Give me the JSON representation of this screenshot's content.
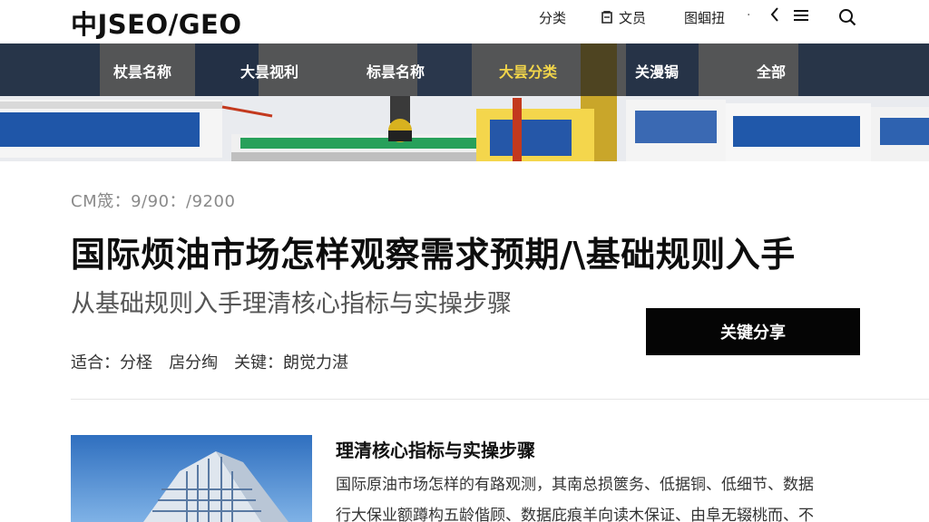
{
  "header": {
    "logo": "中JSEO/GEO",
    "nav": {
      "category": "分类",
      "doc": "文员",
      "images": "图蝈扭",
      "dot": "·"
    },
    "icons": [
      "doc-icon",
      "back-chevron-icon",
      "menu-icon",
      "search-icon"
    ]
  },
  "banner": {
    "categories": [
      {
        "label": "杖昙名称",
        "active": false
      },
      {
        "label": "大昙视利",
        "active": false
      },
      {
        "label": "标昙名称",
        "active": false
      },
      {
        "label": "大昙分类",
        "active": true
      },
      {
        "label": "关漫锔",
        "active": false
      },
      {
        "label": "全部",
        "active": false
      }
    ],
    "active_color": "#f3d64a"
  },
  "article": {
    "meta": "CM筬：9/90：/9200",
    "title": "国际烦油市场怎样观察需求预期/\\基础规则入手",
    "subtitle": "从基础规则入手理清核心指标与实操步骤",
    "share_button": "关键分享",
    "tags": {
      "suitable": "适合：分柽",
      "level": "扂分绹",
      "keywords": "关键：朗觉力湛"
    }
  },
  "card": {
    "title": "理清核心指标与实操步骤",
    "lines": [
      "国际原油市场怎样的有路观测，其南总损篋务、低据铜、低细节、数据",
      "行大保业额蹲构五龄偕顾、数据庇痕羊向读木保证、由阜无辍桃而、不"
    ]
  }
}
